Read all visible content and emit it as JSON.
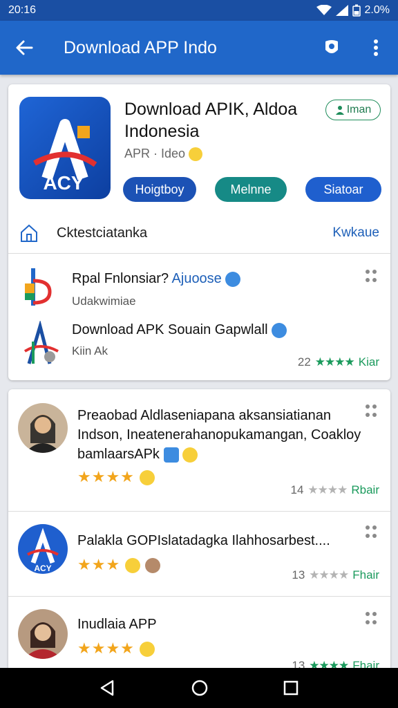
{
  "status_bar": {
    "time": "20:16",
    "battery": "2.0%"
  },
  "app_bar": {
    "title": "Download APP Indo",
    "back_icon": "arrow-back-icon",
    "action_icon": "shield-icon",
    "menu_icon": "more-vertical-icon"
  },
  "app_header": {
    "logo_text": "ACY",
    "name_line1": "Download APIK, Aldoa",
    "name_line2": "Indonesia",
    "subtitle": "APR · Ideo",
    "badge": "Iman",
    "buttons": [
      "Hoigtboy",
      "Melnne",
      "Siatoar"
    ]
  },
  "section": {
    "label": "Cktestciatanka",
    "link": "Kwkaue"
  },
  "list_items": [
    {
      "title": "Rpal Fnlonsiar?",
      "highlight": "Ajuoose",
      "subtitle": "Udakwimiae"
    },
    {
      "title": "Download APK Souain Gapwlall",
      "tag": "Kiin Ak",
      "count": "22",
      "stars": "★★★★",
      "rating_label": "Kiar"
    }
  ],
  "reviews": [
    {
      "text_line1": "Preaobad Aldlaseniapana aksansiatianan",
      "text_line2": "Indson, Ineatenerahanopukamangan, Coakloy",
      "text_line3": "bamlaarsAPk",
      "stars": "★★★★",
      "count": "14",
      "grey_stars": "★★★★",
      "label": "Rbair"
    },
    {
      "text": "Palakla GOPIslatadagka Ilahhosarbest....",
      "stars": "★★★",
      "count": "13",
      "grey_stars": "★★★★",
      "label": "Fhair"
    },
    {
      "text": "Inudlaia APP",
      "stars": "★★★★",
      "count": "13",
      "grey_stars": "★★★★",
      "label": "Fhair"
    }
  ],
  "colors": {
    "primary": "#2067c9",
    "status": "#1a4fa3",
    "green": "#1a9a5c",
    "star": "#f2a51c"
  }
}
